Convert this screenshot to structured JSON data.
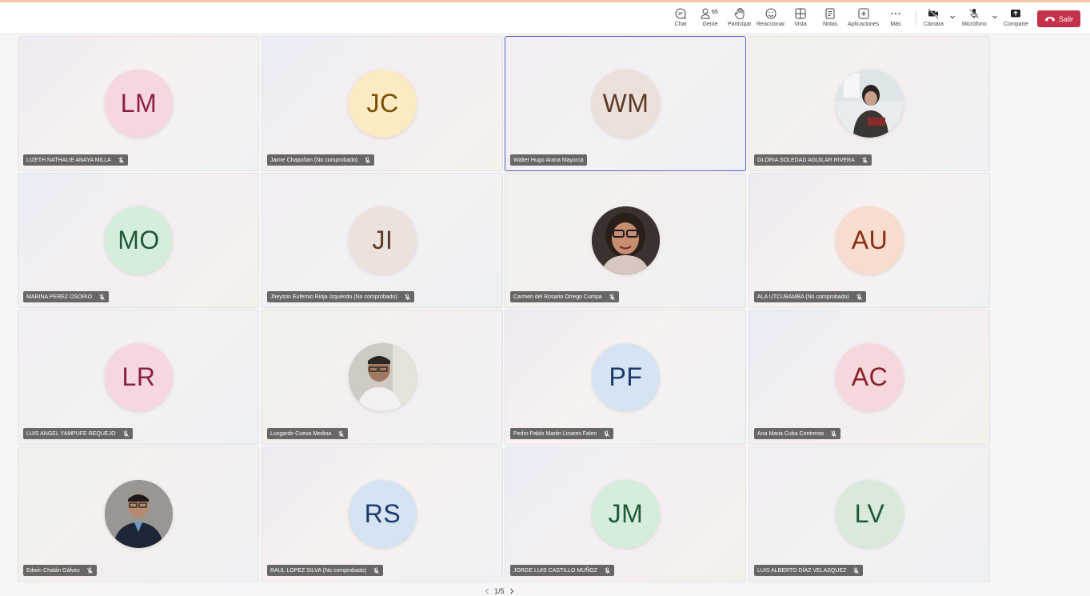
{
  "toolbar": {
    "chat": "Chat",
    "people": "Gente",
    "people_count": "65",
    "raise_hand": "Participar",
    "react": "Reaccionar",
    "view": "Vista",
    "notes": "Notas",
    "apps": "Aplicaciones",
    "more": "Más",
    "camera": "Cámara",
    "mic": "Micrófono",
    "share": "Comparte",
    "leave": "Salir",
    "leave_color": "#c4314b"
  },
  "participants": [
    {
      "name": "LIZETH NATHALIE ANAYA MILLA",
      "initials": "LM",
      "avatar_bg": "#f6d6df",
      "initials_color": "#8a1f41",
      "muted": true,
      "photo": false
    },
    {
      "name": "Jaime Chapoñan (No comprobado)",
      "initials": "JC",
      "avatar_bg": "#fbebc3",
      "initials_color": "#7a4d00",
      "muted": true,
      "photo": false
    },
    {
      "name": "Walter Hugo Arana Mayorca",
      "initials": "WM",
      "avatar_bg": "#ebe0da",
      "initials_color": "#5c3a28",
      "muted": false,
      "photo": false
    },
    {
      "name": "GLORIA SOLEDAD AGUILAR RIVERA",
      "initials": "",
      "avatar_bg": "#c9c4c2",
      "initials_color": "#333333",
      "muted": true,
      "photo": true
    },
    {
      "name": "MARINA PEREZ OSORIO",
      "initials": "MO",
      "avatar_bg": "#d5eedb",
      "initials_color": "#1f5a35",
      "muted": true,
      "photo": false
    },
    {
      "name": "Jheyson Eufemio Rioja Izquierdo (No comprobado)",
      "initials": "JI",
      "avatar_bg": "#ece1dc",
      "initials_color": "#5c3a28",
      "muted": true,
      "photo": false
    },
    {
      "name": "Carmen del Rosario Orrego Cumpa",
      "initials": "",
      "avatar_bg": "#4a3b36",
      "initials_color": "#333333",
      "muted": true,
      "photo": true
    },
    {
      "name": "ALA UTCUBAMBA (No comprobado)",
      "initials": "AU",
      "avatar_bg": "#f7dccf",
      "initials_color": "#8a2c0d",
      "muted": true,
      "photo": false
    },
    {
      "name": "LUIS ANGEL YAMPUFE REQUEJO",
      "initials": "LR",
      "avatar_bg": "#f6d6df",
      "initials_color": "#8a1f41",
      "muted": true,
      "photo": false
    },
    {
      "name": "Luzgardo Cueva Medina",
      "initials": "",
      "avatar_bg": "#b7b3ae",
      "initials_color": "#333333",
      "muted": true,
      "photo": true
    },
    {
      "name": "Pedro Pablo Martin Linares Falen",
      "initials": "PF",
      "avatar_bg": "#d6e3f3",
      "initials_color": "#1b3a6b",
      "muted": true,
      "photo": false
    },
    {
      "name": "Ana Maria Cuba Contreras",
      "initials": "AC",
      "avatar_bg": "#f6d8dc",
      "initials_color": "#8a1f2c",
      "muted": true,
      "photo": false
    },
    {
      "name": "Edwin Chalán Gálvez",
      "initials": "",
      "avatar_bg": "#8f8c88",
      "initials_color": "#333333",
      "muted": true,
      "photo": true
    },
    {
      "name": "RAUL LOPEZ SILVA (No comprobado)",
      "initials": "RS",
      "avatar_bg": "#d6e3f3",
      "initials_color": "#1b3a6b",
      "muted": true,
      "photo": false
    },
    {
      "name": "JORGE LUIS CASTILLO MUÑOZ",
      "initials": "JM",
      "avatar_bg": "#d5eedb",
      "initials_color": "#1f5a35",
      "muted": true,
      "photo": false
    },
    {
      "name": "LUIS ALBERTO DÍAZ VELASQUEZ",
      "initials": "LV",
      "avatar_bg": "#d9eadc",
      "initials_color": "#1f5a35",
      "muted": true,
      "photo": false
    }
  ],
  "pagination": {
    "text": "1/5"
  }
}
